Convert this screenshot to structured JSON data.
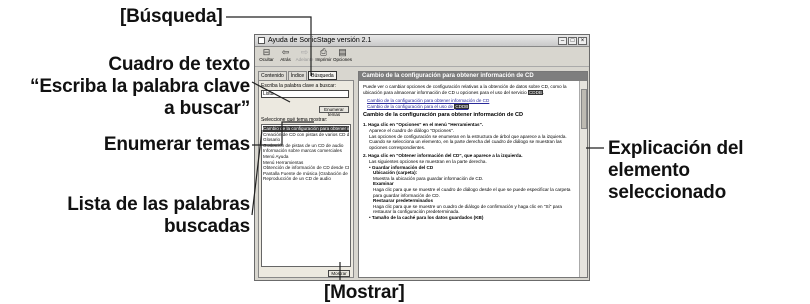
{
  "callouts": {
    "busqueda": "[Búsqueda]",
    "cuadro_1": "Cuadro de texto",
    "cuadro_2": "“Escriba la palabra clave",
    "cuadro_3": "a buscar”",
    "enumerar": "Enumerar temas",
    "lista_1": "Lista de las palabras",
    "lista_2": "buscadas",
    "mostrar": "[Mostrar]",
    "explicacion_1": "Explicación del",
    "explicacion_2": "elemento seleccionado"
  },
  "window": {
    "title": "Ayuda de SonicStage versión 2.1",
    "toolbar": [
      {
        "label": "Ocultar",
        "icon": "hide-icon"
      },
      {
        "label": "Atrás",
        "icon": "back-icon"
      },
      {
        "label": "Adelante",
        "icon": "forward-icon"
      },
      {
        "label": "Imprimir",
        "icon": "print-icon"
      },
      {
        "label": "Opciones",
        "icon": "options-icon"
      }
    ],
    "tabs": [
      "Contenido",
      "Índice",
      "Búsqueda"
    ],
    "active_tab": "Búsqueda"
  },
  "left_pane": {
    "keyword_label": "Escriba la palabra clave a buscar:",
    "keyword_value": "Lista",
    "list_topics_button": "Enumerar temas",
    "select_label": "Seleccione qué tema mostrar:",
    "topics": [
      "Cambio de la configuración para obtener inf",
      "Creación de CD con pistas de varios CD de",
      "Glosario",
      "Grabación de pistas de un CD de audio",
      "Información sobre marcas comerciales",
      "Menú Ayuda",
      "Menú Herramientas",
      "Obtención de información de CD desde CD",
      "Pantalla Fuente de música (Grabación de CD",
      "Reproducción de un CD de audio"
    ],
    "selected_index": 0,
    "show_button": "Mostrar"
  },
  "right_pane": {
    "header": "Cambio de la configuración para obtener información de CD",
    "intro": "Puede ver o cambiar opciones de configuración relativas a la obtención de datos sobre CD, como la ubicación para almacenar información de CD u opciones para el uso del servicio",
    "intro_hl": "CDDB",
    "link_1": "Cambio de la configuración para obtener información de CD",
    "link_2_pre": "Cambio de la configuración para el uso de",
    "link_2_hl": "CDDB",
    "section_title": "Cambio de la configuración para obtener información de CD",
    "step_1": "1.  Haga clic en \"Opciones\" en el menú \"Herramientas\".",
    "step_1_sub": "Aparece el cuadro de diálogo \"Opciones\".",
    "step_1_desc": "Las opciones de configuración se enumeran en la estructura de árbol que aparece a la izquierda. Cuando se selecciona un elemento, en la parte derecha del cuadro de diálogo se muestran las opciones correspondientes.",
    "step_2": "2.  Haga clic en \"Obtener información del CD\", que aparece a la izquierda.",
    "step_2_sub": "Las siguientes opciones se muestran en la parte derecha.",
    "bullet_1": "Guardar información del CD",
    "b1_a": "Ubicación (carpeta):",
    "b1_a_desc": "Muestra la ubicación para guardar información de CD.",
    "b1_b": "Examinar",
    "b1_b_desc": "Haga clic para que se muestre el cuadro de diálogo desde el que se puede especificar la carpeta para guardar información de CD.",
    "b1_c": "Restaurar predeterminados",
    "b1_c_desc": "Haga clic para que se muestre un cuadro de diálogo de confirmación y haga clic en \"Sí\" para restaurar la configuración predeterminada.",
    "bullet_2": "Tamaño de la caché para los datos guardados (KB)"
  }
}
